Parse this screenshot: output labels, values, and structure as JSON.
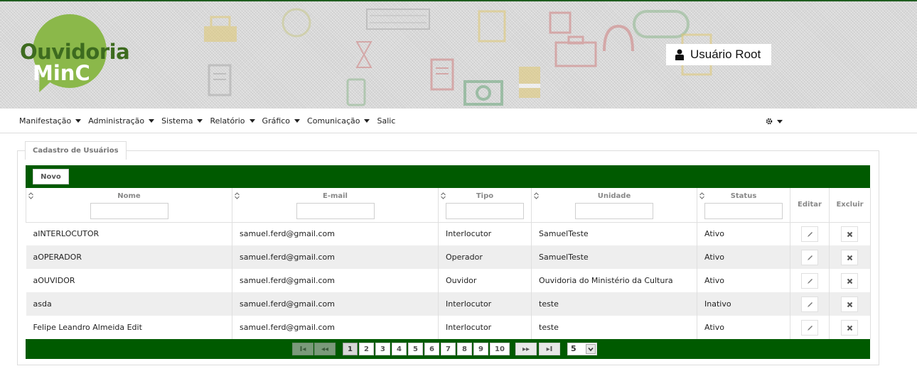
{
  "header": {
    "logo_line1": "Ouvidoria",
    "logo_line2": "MinC",
    "user_label": "Usuário Root",
    "user_icon": "user-icon"
  },
  "nav": {
    "items": [
      {
        "label": "Manifestação",
        "has_caret": true
      },
      {
        "label": "Administração",
        "has_caret": true
      },
      {
        "label": "Sistema",
        "has_caret": true
      },
      {
        "label": "Relatório",
        "has_caret": true
      },
      {
        "label": "Gráfico",
        "has_caret": true
      },
      {
        "label": "Comunicação",
        "has_caret": true
      },
      {
        "label": "Salic",
        "has_caret": false
      }
    ],
    "settings_icon": "gear-icon"
  },
  "panel": {
    "legend": "Cadastro de Usuários",
    "new_button": "Novo"
  },
  "table": {
    "columns": [
      "Nome",
      "E-mail",
      "Tipo",
      "Unidade",
      "Status",
      "Editar",
      "Excluir"
    ],
    "rows": [
      {
        "nome": "aINTERLOCUTOR",
        "email": "samuel.ferd@gmail.com",
        "tipo": "Interlocutor",
        "unidade": "SamuelTeste",
        "status": "Ativo"
      },
      {
        "nome": "aOPERADOR",
        "email": "samuel.ferd@gmail.com",
        "tipo": "Operador",
        "unidade": "SamuelTeste",
        "status": "Ativo"
      },
      {
        "nome": "aOUVIDOR",
        "email": "samuel.ferd@gmail.com",
        "tipo": "Ouvidor",
        "unidade": "Ouvidoria do Ministério da Cultura",
        "status": "Ativo"
      },
      {
        "nome": "asda",
        "email": "samuel.ferd@gmail.com",
        "tipo": "Interlocutor",
        "unidade": "teste",
        "status": "Inativo"
      },
      {
        "nome": "Felipe Leandro Almeida Edit",
        "email": "samuel.ferd@gmail.com",
        "tipo": "Interlocutor",
        "unidade": "teste",
        "status": "Ativo"
      }
    ]
  },
  "pager": {
    "first": "I◂",
    "prev": "◂◂",
    "pages": [
      "1",
      "2",
      "3",
      "4",
      "5",
      "6",
      "7",
      "8",
      "9",
      "10"
    ],
    "current_page": "1",
    "next": "▸▸",
    "last": "▸I",
    "rows_per_page": "5"
  },
  "colors": {
    "brand_green": "#005a00",
    "logo_green": "#8bb84a",
    "logo_dark_green": "#3d6b1f"
  }
}
